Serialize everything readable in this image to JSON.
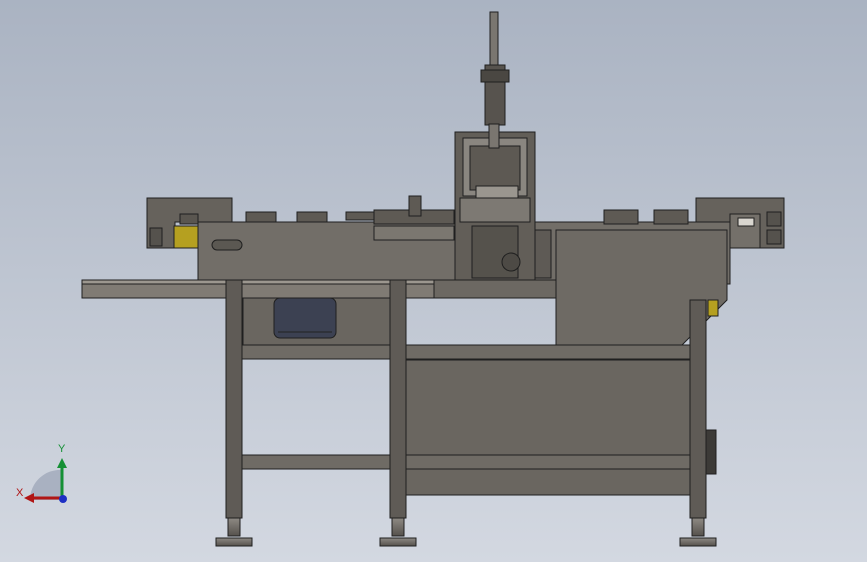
{
  "viewport": {
    "background_top": "#aab3c2",
    "background_bottom": "#d3d8e1",
    "metal_color": "#6e6a64",
    "accent_yellow": "#b5a020"
  },
  "triad": {
    "x_label": "X",
    "y_label": "Y",
    "x_color": "#b01515",
    "y_color": "#159035",
    "z_color": "#1d2fc4"
  }
}
